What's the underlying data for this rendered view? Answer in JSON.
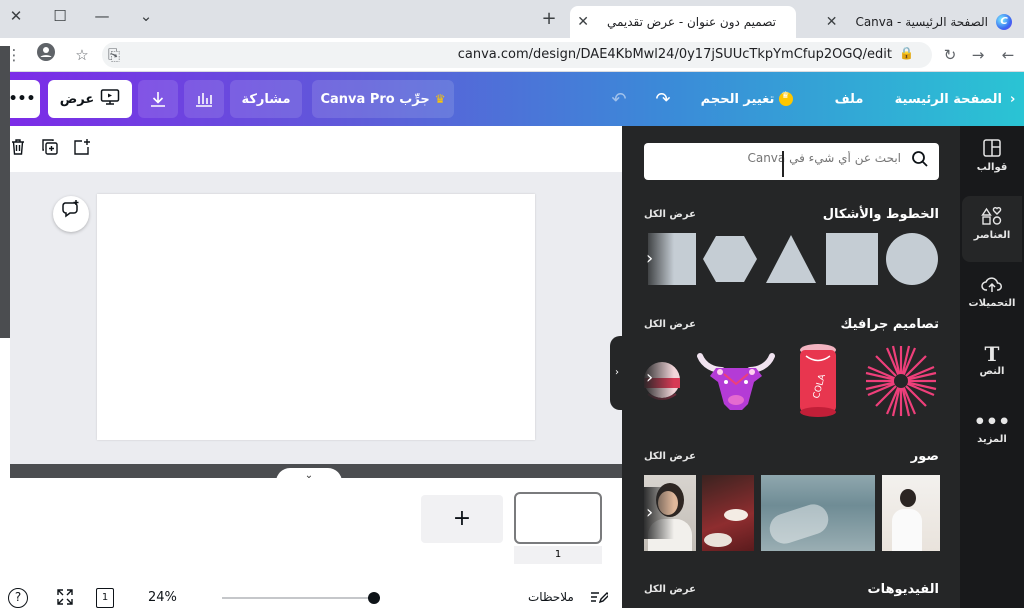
{
  "browser": {
    "tabs": [
      {
        "title": "الصفحة الرئيسية - Canva",
        "active": false
      },
      {
        "title": "تصميم دون عنوان - عرض تقديمي",
        "active": true
      }
    ],
    "url": "canva.com/design/DAE4KbMwl24/0y17jSUUcTkpYmCfup2OGQ/edit",
    "window_controls": {
      "close": "✕",
      "maximize": "☐",
      "minimize": "—",
      "dropdown": "⌄"
    }
  },
  "toolbar": {
    "home": "الصفحة الرئيسية",
    "file": "ملف",
    "resize": "تغيير الحجم",
    "try_pro": "جرِّب Canva Pro",
    "share": "مشاركة",
    "present": "عرض",
    "more": "•••",
    "accent_colors": [
      "#7d2ae8",
      "#2ac4d4"
    ]
  },
  "sidebar": {
    "items": [
      {
        "label": "قوالب",
        "icon": "templates-icon"
      },
      {
        "label": "العناصر",
        "icon": "elements-icon"
      },
      {
        "label": "التحميلات",
        "icon": "upload-icon"
      },
      {
        "label": "النص",
        "icon": "text-icon"
      },
      {
        "label": "المزيد",
        "icon": "more-icon"
      }
    ]
  },
  "panel": {
    "search_placeholder": "ابحث عن أي شيء في Canva",
    "sections": [
      {
        "title": "الخطوط والأشكال",
        "see_all": "عرض الكل"
      },
      {
        "title": "تصاميم جرافيك",
        "see_all": "عرض الكل"
      },
      {
        "title": "صور",
        "see_all": "عرض الكل"
      },
      {
        "title": "الفيديوهات",
        "see_all": "عرض الكل"
      }
    ],
    "colors": {
      "background": "#252627",
      "shape": "#c5cdd4"
    }
  },
  "editor": {
    "page_number": "1",
    "add_page": "+"
  },
  "footer": {
    "notes": "ملاحظات",
    "zoom": "24%",
    "page_count": "1",
    "help": "?"
  }
}
